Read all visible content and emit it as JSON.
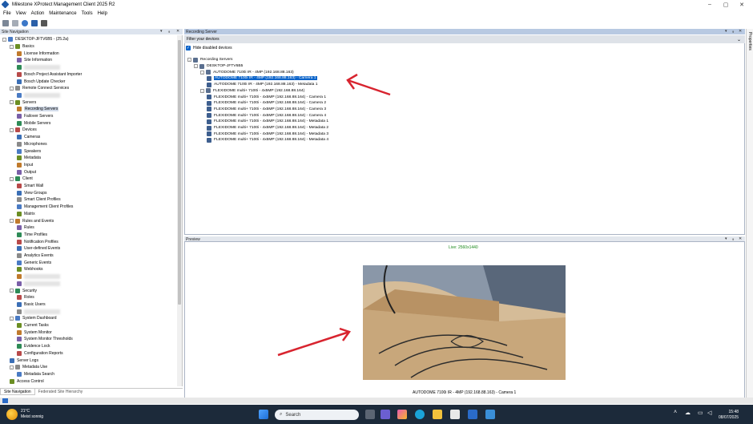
{
  "window": {
    "title": "Milestone XProtect Management Client 2025 R2",
    "controls": [
      "–",
      "▢",
      "✕"
    ]
  },
  "menu": [
    "File",
    "View",
    "Action",
    "Maintenance",
    "Tools",
    "Help"
  ],
  "left_panel": {
    "header": "Site Navigation",
    "tree": [
      {
        "label": "DESKTOP-JFTV6B5 - (25.2a)",
        "indent": 0,
        "exp": "-"
      },
      {
        "label": "Basics",
        "indent": 1,
        "exp": "-"
      },
      {
        "label": "License Information",
        "indent": 2
      },
      {
        "label": "Site Information",
        "indent": 2
      },
      {
        "label": "",
        "indent": 2,
        "blur": true
      },
      {
        "label": "Bosch Project Assistant Importer",
        "indent": 2
      },
      {
        "label": "Bosch Update Checker",
        "indent": 2
      },
      {
        "label": "Remote Connect Services",
        "indent": 1,
        "exp": "-"
      },
      {
        "label": "",
        "indent": 2,
        "blur": true
      },
      {
        "label": "Servers",
        "indent": 1,
        "exp": "-"
      },
      {
        "label": "Recording Servers",
        "indent": 2,
        "selected": true
      },
      {
        "label": "Failover Servers",
        "indent": 2
      },
      {
        "label": "Mobile Servers",
        "indent": 2
      },
      {
        "label": "Devices",
        "indent": 1,
        "exp": "-"
      },
      {
        "label": "Cameras",
        "indent": 2
      },
      {
        "label": "Microphones",
        "indent": 2
      },
      {
        "label": "Speakers",
        "indent": 2
      },
      {
        "label": "Metadata",
        "indent": 2
      },
      {
        "label": "Input",
        "indent": 2
      },
      {
        "label": "Output",
        "indent": 2
      },
      {
        "label": "Client",
        "indent": 1,
        "exp": "-"
      },
      {
        "label": "Smart Wall",
        "indent": 2
      },
      {
        "label": "View Groups",
        "indent": 2
      },
      {
        "label": "Smart Client Profiles",
        "indent": 2
      },
      {
        "label": "Management Client Profiles",
        "indent": 2
      },
      {
        "label": "Matrix",
        "indent": 2
      },
      {
        "label": "Rules and Events",
        "indent": 1,
        "exp": "-"
      },
      {
        "label": "Rules",
        "indent": 2
      },
      {
        "label": "Time Profiles",
        "indent": 2
      },
      {
        "label": "Notification Profiles",
        "indent": 2
      },
      {
        "label": "User-defined Events",
        "indent": 2
      },
      {
        "label": "Analytics Events",
        "indent": 2
      },
      {
        "label": "Generic Events",
        "indent": 2
      },
      {
        "label": "Webhooks",
        "indent": 2
      },
      {
        "label": "",
        "indent": 2,
        "blur": true
      },
      {
        "label": "",
        "indent": 2,
        "blur": true
      },
      {
        "label": "Security",
        "indent": 1,
        "exp": "-"
      },
      {
        "label": "Roles",
        "indent": 2
      },
      {
        "label": "Basic Users",
        "indent": 2
      },
      {
        "label": "",
        "indent": 2,
        "blur": true
      },
      {
        "label": "System Dashboard",
        "indent": 1,
        "exp": "-"
      },
      {
        "label": "Current Tasks",
        "indent": 2
      },
      {
        "label": "System Monitor",
        "indent": 2
      },
      {
        "label": "System Monitor Thresholds",
        "indent": 2
      },
      {
        "label": "Evidence Lock",
        "indent": 2
      },
      {
        "label": "Configuration Reports",
        "indent": 2
      },
      {
        "label": "Server Logs",
        "indent": 1
      },
      {
        "label": "Metadata Use",
        "indent": 1,
        "exp": "-"
      },
      {
        "label": "Metadata Search",
        "indent": 2
      },
      {
        "label": "Access Control",
        "indent": 1
      }
    ],
    "tabs": [
      "Site Navigation",
      "Federated Site Hierarchy"
    ]
  },
  "recording_panel": {
    "header": "Recording Server",
    "filter_placeholder": "Filter your devices",
    "hide_disabled": "Hide disabled devices",
    "tree": [
      {
        "label": "Recording Servers",
        "indent": 0,
        "exp": "-"
      },
      {
        "label": "DESKTOP-JFTV6B5",
        "indent": 1,
        "exp": "-"
      },
      {
        "label": "AUTODOME 7100i IR - 4MP (192.168.88.163)",
        "indent": 2,
        "exp": "-"
      },
      {
        "label": "AUTODOME 7100i IR - 4MP (192.168.88.163) - Camera 1",
        "indent": 3,
        "selected": true
      },
      {
        "label": "AUTODOME 7100i IR - 4MP (192.168.88.163) - Metadata 1",
        "indent": 3
      },
      {
        "label": "FLEXIDOME multi+ 7100i - 4x5MP (192.168.88.164)",
        "indent": 2,
        "exp": "-"
      },
      {
        "label": "FLEXIDOME multi+ 7100i - 4x5MP (192.168.88.164) - Camera 1",
        "indent": 3
      },
      {
        "label": "FLEXIDOME multi+ 7100i - 4x5MP (192.168.88.164) - Camera 2",
        "indent": 3
      },
      {
        "label": "FLEXIDOME multi+ 7100i - 4x5MP (192.168.88.164) - Camera 3",
        "indent": 3
      },
      {
        "label": "FLEXIDOME multi+ 7100i - 4x5MP (192.168.88.164) - Camera 4",
        "indent": 3
      },
      {
        "label": "FLEXIDOME multi+ 7100i - 4x5MP (192.168.88.164) - Metadata 1",
        "indent": 3
      },
      {
        "label": "FLEXIDOME multi+ 7100i - 4x5MP (192.168.88.164) - Metadata 2",
        "indent": 3
      },
      {
        "label": "FLEXIDOME multi+ 7100i - 4x5MP (192.168.88.164) - Metadata 3",
        "indent": 3
      },
      {
        "label": "FLEXIDOME multi+ 7100i - 4x5MP (192.168.88.164) - Metadata 4",
        "indent": 3
      }
    ]
  },
  "preview": {
    "header": "Preview",
    "live_label": "Live: 2560x1440",
    "caption": "AUTODOME 7100i IR - 4MP (192.168.88.163) - Camera 1"
  },
  "properties_label": "Properties",
  "taskbar": {
    "temp": "21°C",
    "weather": "Meist sonnig",
    "search": "Search",
    "time": "15:48",
    "date": "08/07/2025"
  },
  "colors": {
    "selection": "#0a63c9",
    "annotation_arrow": "#d8242f",
    "taskbar": "#1c2a3a"
  }
}
